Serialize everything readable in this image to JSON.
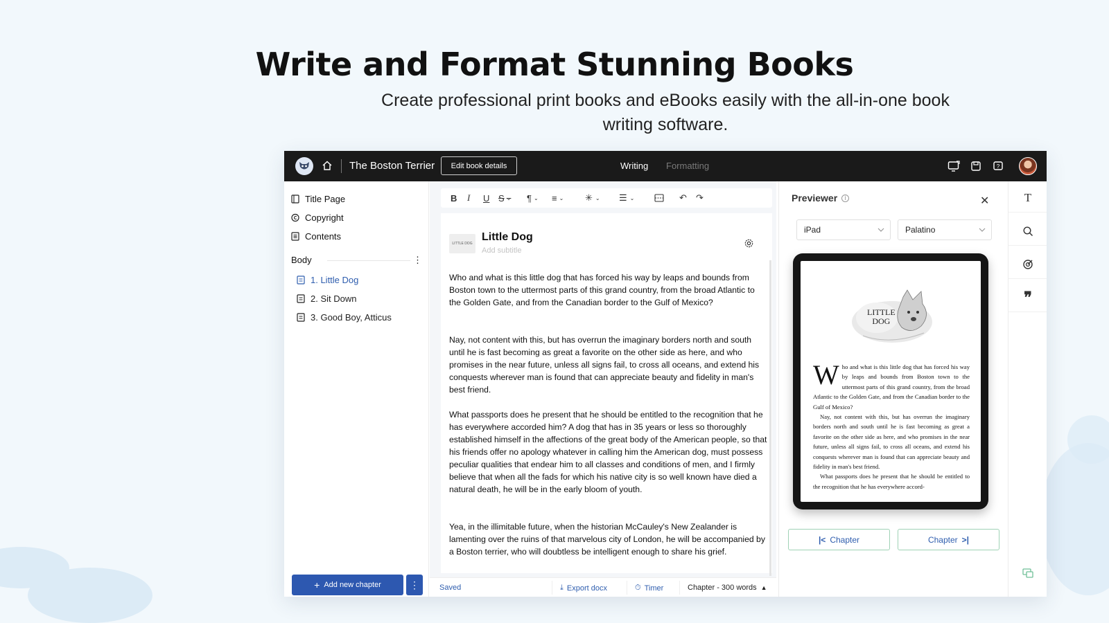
{
  "hero": {
    "title": "Write and Format Stunning Books",
    "subtitle": "Create professional print books and eBooks easily with the all-in-one book writing software."
  },
  "topbar": {
    "book_title": "The Boston Terrier",
    "edit_button": "Edit book details",
    "tabs": [
      {
        "label": "Writing",
        "active": true
      },
      {
        "label": "Formatting",
        "active": false
      }
    ],
    "icons": [
      "display-icon",
      "save-icon",
      "help-icon"
    ]
  },
  "sidebar": {
    "front_matter": [
      {
        "label": "Title Page",
        "icon": "title-page-icon"
      },
      {
        "label": "Copyright",
        "icon": "copyright-icon"
      },
      {
        "label": "Contents",
        "icon": "contents-icon"
      }
    ],
    "body_label": "Body",
    "chapters": [
      {
        "label": "1. Little Dog",
        "active": true
      },
      {
        "label": "2. Sit Down",
        "active": false
      },
      {
        "label": "3. Good Boy, Atticus",
        "active": false
      }
    ],
    "add_chapter_label": "Add new chapter"
  },
  "editor": {
    "chapter_title": "Little Dog",
    "subtitle_placeholder": "Add subtitle",
    "thumb_label": "LITTLE DOG",
    "paragraphs": [
      "Who and what is this little dog that has forced his way by leaps and bounds from Boston town to the uttermost parts of this grand country, from the broad Atlantic to the Golden Gate, and from the Canadian border to the Gulf of Mexico?",
      "Nay, not content with this, but has overrun the imaginary borders north and south until he is fast becoming as great a favorite on the other side as here, and who promises in the near future, unless all signs fail, to cross all oceans, and extend his conquests wherever man is found that can appreciate beauty and fidelity in man's best friend.",
      "What passports does he present that he should be entitled to the recognition that he has everywhere accorded him? A dog that has in 35 years or less so thoroughly established himself in the affections of the great body of the American people, so that his friends offer no apology whatever in calling him the American dog, must possess peculiar qualities that endear him to all classes and conditions of men, and I firmly believe that when all the fads for which his native city is so well known have died a natural death, he will be in the early bloom of youth.",
      " Yea, in the illimitable future, when the historian McCauley's New Zealander is lamenting over the ruins of that marvelous city of London, he will be accompanied by a Boston terrier, who will doubtless be intelligent enough to share his grief."
    ],
    "status": {
      "saved": "Saved",
      "export": "Export docx",
      "timer": "Timer",
      "word_count": "Chapter - 300 words"
    }
  },
  "previewer": {
    "title": "Previewer",
    "device": "iPad",
    "font": "Palatino",
    "art_text_1": "LITTLE",
    "art_text_2": "DOG",
    "drop_cap": "W",
    "book_text_first": "ho and what is this little dog that has forced his way by leaps and bounds from Boston town to the uttermost parts of this grand country, from the broad Atlantic to the Golden Gate, and from the Canadian border to the Gulf of Mexico?",
    "book_text_second": "Nay, not content with this, but has overrun the imaginary borders north and south until he is fast becoming as great a favorite on the other side as here, and who promises in the near future, unless all signs fail, to cross all oceans, and extend his conquests wherever man is found that can appreciate beauty and fidelity in man's best friend.",
    "book_text_third": "What passports does he present that he should be entitled to the recognition that he has everywhere accord-",
    "prev_label": "Chapter",
    "next_label": "Chapter"
  },
  "colors": {
    "accent": "#2d58b0",
    "topbar": "#1a1a1a",
    "background": "#f2f8fc"
  }
}
